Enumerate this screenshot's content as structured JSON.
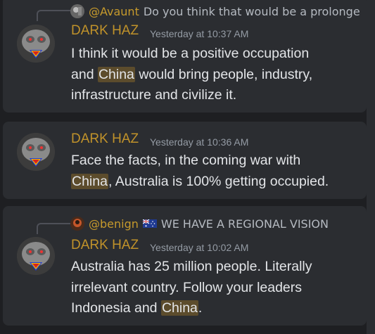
{
  "messages": [
    {
      "reply": {
        "name": "@Avaunt",
        "text": "Do you think that would be a prolonge"
      },
      "author": "DARK HAZ",
      "timestamp": "Yesterday at 10:37 AM",
      "lines": [
        [
          "I think it would be a positive occupation"
        ],
        [
          "and ",
          {
            "hl": "China"
          },
          " would bring people, industry,"
        ],
        [
          "infrastructure and civilize it."
        ]
      ]
    },
    {
      "author": "DARK HAZ",
      "timestamp": "Yesterday at 10:36 AM",
      "lines": [
        [
          "Face the facts, in the coming war with"
        ],
        [
          {
            "hl": "China"
          },
          ", Australia is 100% getting occupied."
        ]
      ]
    },
    {
      "reply": {
        "name": "@benign",
        "text": "WE HAVE A REGIONAL VISION",
        "flag": "australia-flag-icon"
      },
      "author": "DARK HAZ",
      "timestamp": "Yesterday at 10:02 AM",
      "lines": [
        [
          "Australia has 25 million people. Literally"
        ],
        [
          "irrelevant country. Follow your leaders"
        ],
        [
          "Indonesia and ",
          {
            "hl": "China"
          },
          "."
        ]
      ]
    }
  ],
  "colors": {
    "background": "#1e1f22",
    "card": "#2b2d31",
    "username": "#c0922a",
    "highlight": "#5c4c2c",
    "timestamp": "#949ba4"
  }
}
